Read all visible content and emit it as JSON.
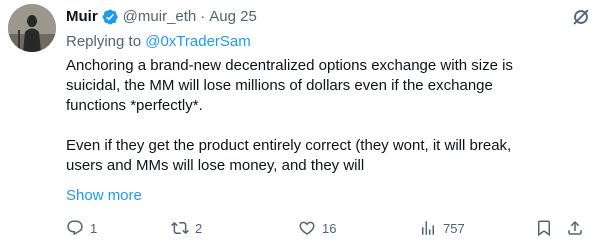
{
  "user": {
    "name": "Muir",
    "handle": "@muir_eth",
    "separator": "·",
    "date": "Aug 25"
  },
  "reply": {
    "prefix": "Replying to ",
    "mention": "@0xTraderSam"
  },
  "body": {
    "paragraph1": "Anchoring a brand-new decentralized options exchange with size is\nsuicidal, the MM will lose millions of dollars even if the exchange\nfunctions *perfectly*.",
    "paragraph2": "Even if they get the product entirely correct (they wont, it will break,\nusers and MMs will lose money,  and they will"
  },
  "show_more": "Show more",
  "actions": {
    "replies": "1",
    "reposts": "2",
    "likes": "16",
    "views": "757"
  },
  "colors": {
    "accent": "#1d9bf0",
    "muted": "#536471",
    "text": "#0f1419"
  },
  "icons": [
    "avatar",
    "verified-badge-icon",
    "grok-icon",
    "reply-icon",
    "repost-icon",
    "like-icon",
    "views-icon",
    "bookmark-icon",
    "share-icon"
  ]
}
